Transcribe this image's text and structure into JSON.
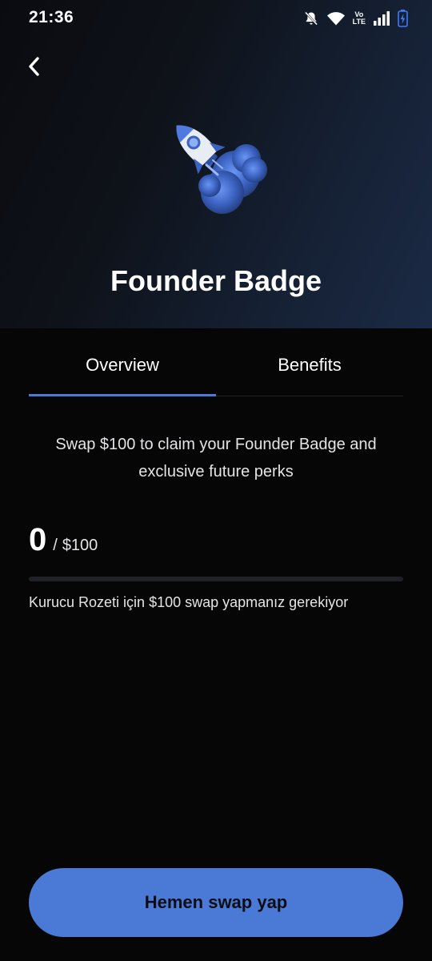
{
  "status_bar": {
    "time": "21:36",
    "volte_top": "Vo",
    "volte_bottom": "LTE",
    "icons": [
      "notifications-off-icon",
      "wifi-icon",
      "volte-icon",
      "signal-icon",
      "battery-charging-icon"
    ]
  },
  "header": {
    "back_icon": "chevron-left-icon",
    "badge_icon": "rocket-icon",
    "title": "Founder Badge"
  },
  "tabs": [
    {
      "label": "Overview",
      "active": true
    },
    {
      "label": "Benefits",
      "active": false
    }
  ],
  "overview": {
    "description": "Swap $100 to claim your Founder Badge and exclusive future perks",
    "progress": {
      "current": "0",
      "separator": "/",
      "target": "$100",
      "fraction": 0
    },
    "requirement": "Kurucu Rozeti için $100 swap yapmanız gerekiyor"
  },
  "cta": {
    "label": "Hemen swap yap"
  },
  "colors": {
    "accent": "#4a7ad6",
    "background": "#060607",
    "track": "#1f2126",
    "battery": "#3d7bff"
  }
}
